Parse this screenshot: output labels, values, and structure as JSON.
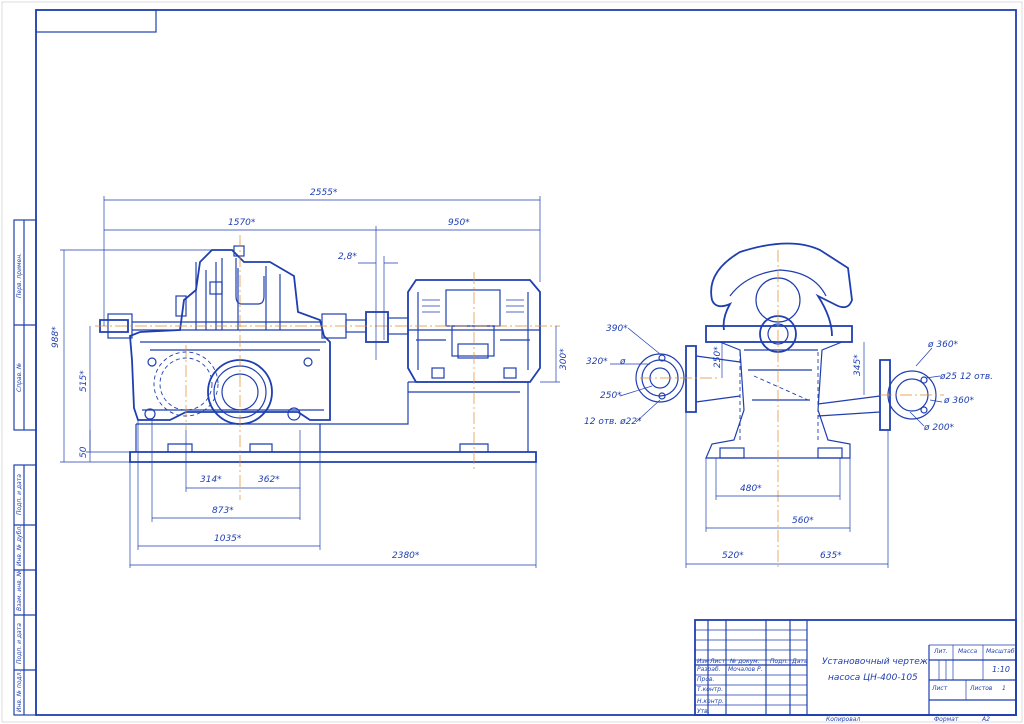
{
  "colors": {
    "line": "#1f3fb0",
    "axis": "#e08a2c",
    "paper": "#ffffff"
  },
  "dimensions": {
    "front": {
      "overall_length": "2555*",
      "to_coupling": "1570*",
      "motor_length": "950*",
      "gap": "2,8*",
      "height_total": "988*",
      "height_axis": "515*",
      "base_height": "50",
      "motor_axis": "300*",
      "pump_a": "314*",
      "pump_b": "362*",
      "pump_feet": "873*",
      "pump_frame": "1035*",
      "base_length": "2380*"
    },
    "side": {
      "suction_outer": "390*",
      "suction_bolt": "320*",
      "suction_phi": "ø",
      "suction_bore": "250*",
      "suction_holes": "12 отв. ø22*",
      "suction_height": "250*",
      "discharge_height": "345*",
      "discharge_outer": "ø 360*",
      "discharge_holes": "ø25 12 отв.",
      "discharge_bolt": "ø 360*",
      "discharge_bore": "ø 200*",
      "feet_inner": "480*",
      "feet_outer": "560*",
      "left_half": "520*",
      "right_half": "635*"
    }
  },
  "side_stamps": [
    "Перв. примен.",
    "Справ. №",
    "Подп. и дата",
    "Инв. № дубл.",
    "Взам. инв. №",
    "Подп. и дата",
    "Инв. № подл."
  ],
  "title_block": {
    "title_line1": "Установочный чертеж",
    "title_line2": "насоса ЦН-400-105",
    "col_headers": [
      "Изм",
      "Лист",
      "№ докум.",
      "Подп.",
      "Дата"
    ],
    "row_labels": [
      "Разраб.",
      "Пров.",
      "Т.контр.",
      "Н.контр.",
      "Утв."
    ],
    "developer": "Мочалов Р.",
    "lit_label": "Лит.",
    "mass_label": "Масса",
    "scale_label": "Масштаб",
    "scale_value": "1:10",
    "sheet_label": "Лист",
    "sheets_label": "Листов",
    "sheets_value": "1",
    "copied": "Копировал",
    "format_label": "Формат",
    "format_value": "А2"
  }
}
